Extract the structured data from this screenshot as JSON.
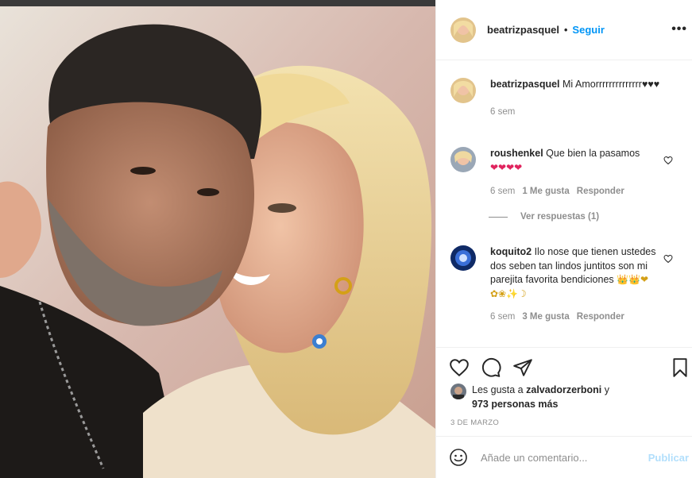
{
  "post": {
    "username": "beatrizpasquel",
    "separator": "•",
    "follow_label": "Seguir",
    "more_icon": "more-horizontal-icon",
    "more_label": "•••"
  },
  "comments": [
    {
      "username": "beatrizpasquel",
      "text": "Mi Amorrrrrrrrrrrrrr♥♥♥",
      "time": "6 sem"
    },
    {
      "username": "roushenkel",
      "text": "Que bien la pasamos",
      "emojis": "❤❤❤❤",
      "time": "6 sem",
      "likes": "1 Me gusta",
      "reply_label": "Responder"
    },
    {
      "username": "koquito2",
      "text": "Ilo nose que tienen ustedes dos seben tan lindos juntitos son mi parejita favorita bendiciones",
      "emojis": "👑👑❤✿❀✨☽",
      "time": "6 sem",
      "likes": "3 Me gusta",
      "reply_label": "Responder"
    }
  ],
  "view_replies": "Ver respuestas (1)",
  "likes_line": {
    "prefix": "Les gusta a",
    "user": "zalvadorzerboni",
    "conj": "y",
    "count": "973 personas más"
  },
  "date": "3 DE MARZO",
  "add_comment": {
    "placeholder": "Añade un comentario...",
    "publish_label": "Publicar"
  },
  "colors": {
    "link": "#0095f6",
    "muted": "#8e8e8e",
    "publish_disabled": "#b2dffc",
    "heart": "#e0245e"
  }
}
